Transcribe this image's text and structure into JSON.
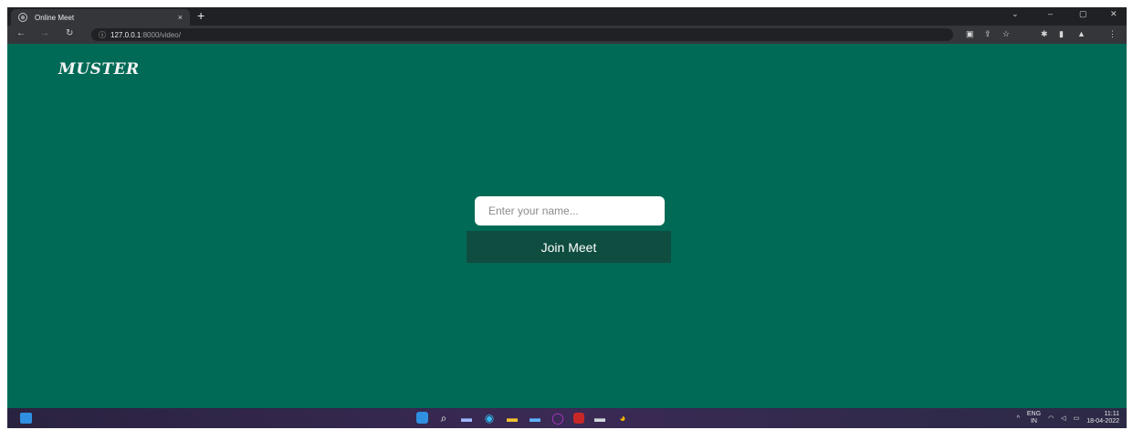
{
  "browser": {
    "tab_title": "Online Meet",
    "tab_close": "×",
    "new_tab": "+",
    "window_controls": {
      "collapse": "⌄",
      "minimize": "–",
      "maximize": "▢",
      "close": "✕"
    },
    "nav": {
      "back": "←",
      "forward": "→",
      "reload": "↻"
    },
    "url_host": "127.0.0.1",
    "url_path": ":8000/video/"
  },
  "page": {
    "logo": "MUSTER",
    "name_placeholder": "Enter your name...",
    "join_label": "Join Meet",
    "background_color": "#006a56",
    "button_color": "#0f4d40"
  },
  "taskbar": {
    "lang_top": "ENG",
    "lang_bottom": "IN",
    "time": "11:11",
    "date": "18-04-2022"
  }
}
